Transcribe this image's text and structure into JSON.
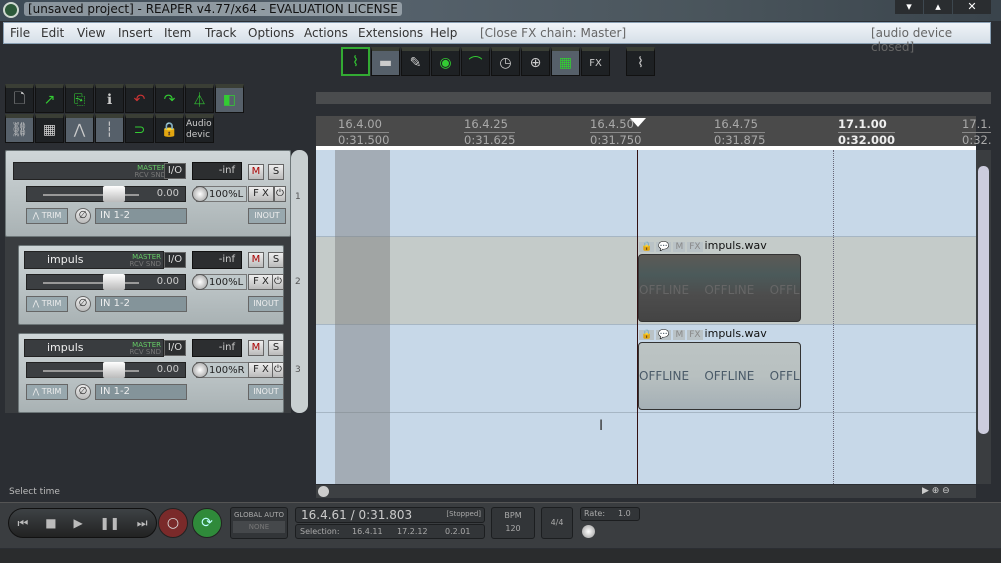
{
  "window": {
    "title": "[unsaved project] - REAPER v4.77/x64 - EVALUATION LICENSE",
    "controls": [
      "▾",
      "▴",
      "✕"
    ]
  },
  "menu": {
    "items": [
      "File",
      "Edit",
      "View",
      "Insert",
      "Item",
      "Track",
      "Options",
      "Actions",
      "Extensions",
      "Help"
    ],
    "fx_chain": "[Close FX chain: Master]",
    "audio_status": "[audio device closed]"
  },
  "top_toolbar": [
    "envelope-window-icon",
    "move-items-icon",
    "pencil-icon",
    "show-env-icon",
    "env-points-icon",
    "snap-time-icon",
    "zoom-icon",
    "grid-icon",
    "fx-chain-icon",
    "open-media-icon"
  ],
  "left_toolbar": {
    "row1": [
      "new-project-icon",
      "open-project-icon",
      "save-project-icon",
      "project-info-icon",
      "undo-icon",
      "redo-icon",
      "metronome-icon",
      "ripple-icon"
    ],
    "row2": [
      "lock-icon",
      "snap-icon",
      "envelope-icon",
      "grid-icon",
      "loop-icon",
      "item-lock-icon"
    ],
    "audio_device": "Audio devic"
  },
  "ruler": {
    "marks": [
      {
        "beat": "16.4.00",
        "time": "0:31.500"
      },
      {
        "beat": "16.4.25",
        "time": "0:31.625"
      },
      {
        "beat": "16.4.50",
        "time": "0:31.750"
      },
      {
        "beat": "16.4.75",
        "time": "0:31.875"
      },
      {
        "beat": "17.1.00",
        "time": "0:32.000"
      },
      {
        "beat": "17.1.",
        "time": "0:32."
      }
    ]
  },
  "tracks": [
    {
      "number": "1",
      "name": "",
      "route": "MASTER",
      "route2": "RCV SND",
      "io": "I/O",
      "meter": "-inf",
      "mute": "M",
      "solo": "S",
      "volume": "0.00",
      "pan": "100%L",
      "fx": "F X",
      "trim": "TRIM",
      "input": "IN 1-2",
      "inout": "INOUT"
    },
    {
      "number": "2",
      "name": "impuls",
      "route": "MASTER",
      "route2": "RCV SND",
      "io": "I/O",
      "meter": "-inf",
      "mute": "M",
      "solo": "S",
      "volume": "0.00",
      "pan": "100%L",
      "fx": "F X",
      "trim": "TRIM",
      "input": "IN 1-2",
      "inout": "INOUT"
    },
    {
      "number": "3",
      "name": "impuls",
      "route": "MASTER",
      "route2": "RCV SND",
      "io": "I/O",
      "meter": "-inf",
      "mute": "M",
      "solo": "S",
      "volume": "0.00",
      "pan": "100%R",
      "fx": "F X",
      "trim": "TRIM",
      "input": "IN 1-2",
      "inout": "INOUT"
    }
  ],
  "items": [
    {
      "name": "impuls.wav",
      "offline": [
        "OFFLINE",
        "OFFLINE",
        "OFFLI..."
      ],
      "buttons": [
        "🔒",
        "💬",
        "M",
        "FX"
      ]
    },
    {
      "name": "impuls.wav",
      "offline": [
        "OFFLINE",
        "OFFLINE",
        "OFFLI..."
      ],
      "buttons": [
        "🔒",
        "💬",
        "M",
        "FX"
      ]
    }
  ],
  "status": "Select time",
  "transport": {
    "global_auto": "GLOBAL AUTO",
    "auto_mode": "NONE",
    "position": "16.4.61 / 0:31.803",
    "state": "[Stopped]",
    "selection_label": "Selection:",
    "sel_start": "16.4.11",
    "sel_end": "17.2.12",
    "sel_len": "0.2.01",
    "bpm_label": "BPM",
    "bpm": "120",
    "timesig": "4/4",
    "rate_label": "Rate:",
    "rate": "1.0"
  }
}
